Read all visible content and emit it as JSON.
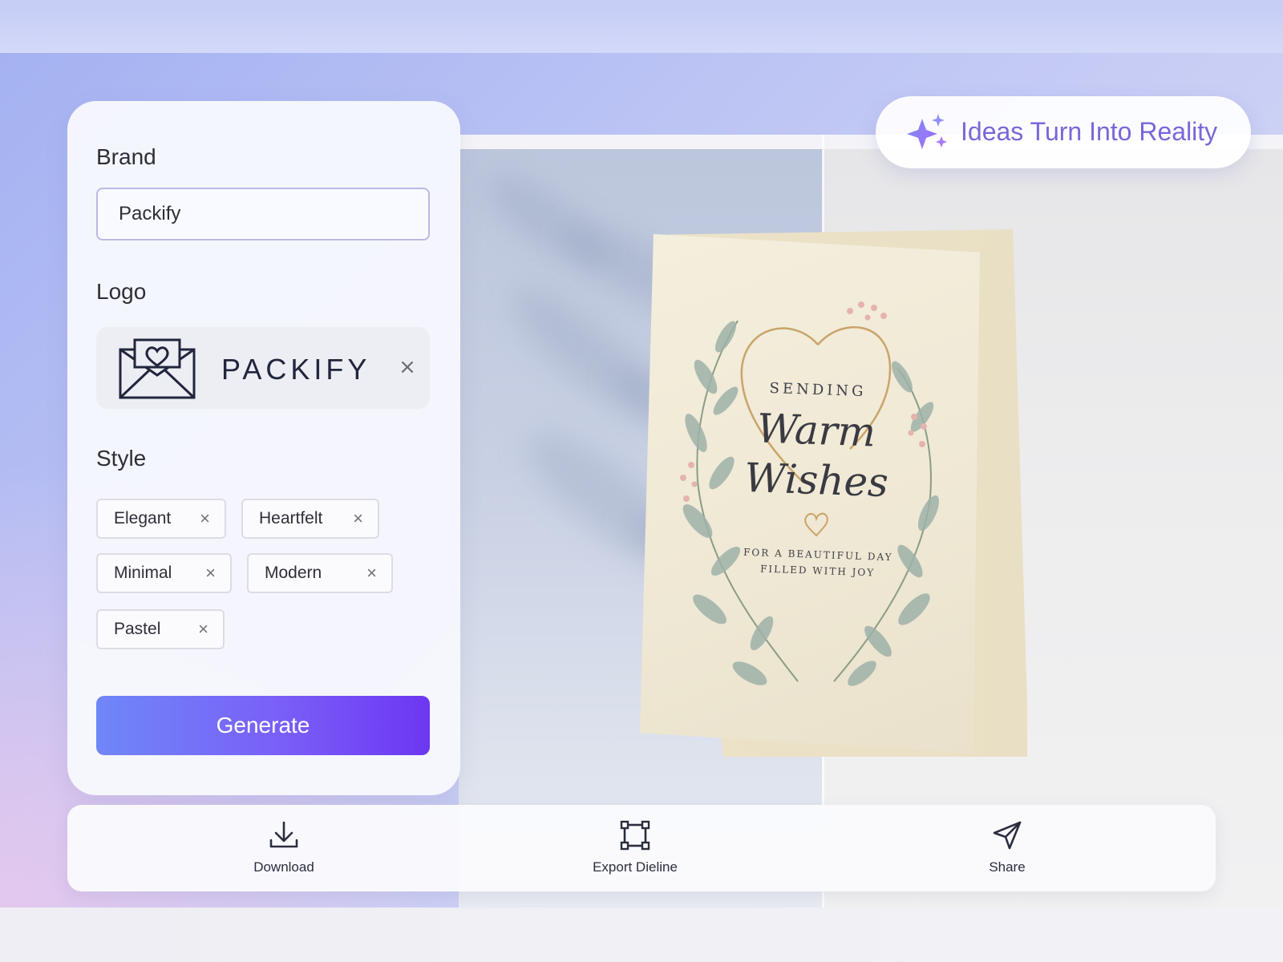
{
  "badge": {
    "text": "Ideas Turn Into Reality",
    "icon": "sparkle-icon",
    "color": "#7a66d8"
  },
  "panel": {
    "brand_label": "Brand",
    "brand_value": "Packify",
    "logo_label": "Logo",
    "logo_wordmark": "PACKIFY",
    "logo_icon": "envelope-heart-icon",
    "style_label": "Style",
    "styles": [
      "Elegant",
      "Heartfelt",
      "Minimal",
      "Modern",
      "Pastel"
    ],
    "generate_label": "Generate",
    "accent": "#7a5ff7"
  },
  "card": {
    "line1": "SENDING",
    "line2": "Warm",
    "line3": "Wishes",
    "line4": "FOR A BEAUTIFUL DAY",
    "line5": "FILLED WITH JOY"
  },
  "actions": {
    "download_label": "Download",
    "export_label": "Export Dieline",
    "share_label": "Share"
  }
}
